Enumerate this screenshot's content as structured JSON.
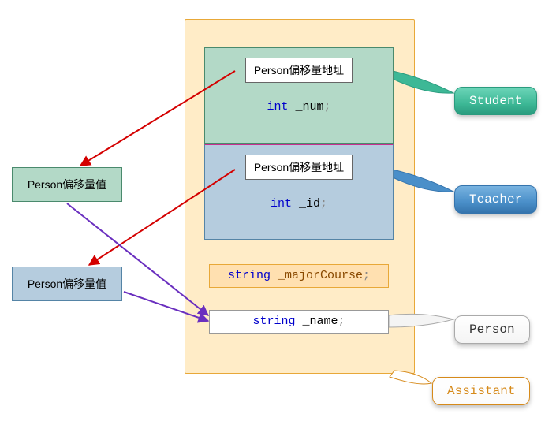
{
  "assistant_container": {
    "label": "Assistant"
  },
  "student_block": {
    "addr_label": "Person偏移量地址",
    "member": {
      "type": "int",
      "name": "_num"
    },
    "callout": "Student"
  },
  "teacher_block": {
    "addr_label": "Person偏移量地址",
    "member": {
      "type": "int",
      "name": "_id"
    },
    "callout": "Teacher"
  },
  "major_member": {
    "type": "string",
    "name": "_majorCourse"
  },
  "name_member": {
    "type": "string",
    "name": "_name"
  },
  "person_callout": "Person",
  "offset_green": {
    "label": "Person偏移量值"
  },
  "offset_blue": {
    "label": "Person偏移量值"
  },
  "arrows": {
    "student_addr_to_green": {
      "color": "red",
      "from": "student_block.addr",
      "to": "offset_green"
    },
    "teacher_addr_to_blue": {
      "color": "red",
      "from": "teacher_block.addr",
      "to": "offset_blue"
    },
    "green_to_name": {
      "color": "purple",
      "from": "offset_green",
      "to": "name_member"
    },
    "blue_to_name": {
      "color": "purple",
      "from": "offset_blue",
      "to": "name_member"
    }
  }
}
